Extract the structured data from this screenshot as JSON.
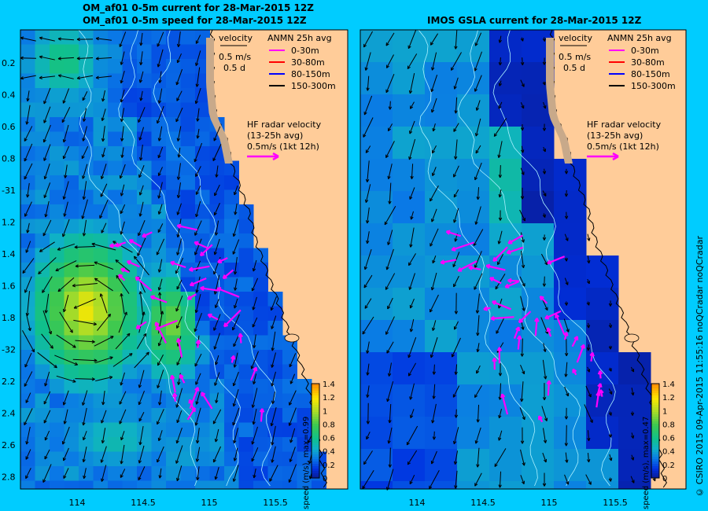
{
  "left_panel": {
    "title_line1": "OM_af01 0-5m current for 28-Mar-2015 12Z",
    "title_line2": "OM_af01 0-5m speed for 28-Mar-2015 12Z",
    "colorbar_label": "speed (m/s), max=0.99"
  },
  "right_panel": {
    "title_line1": "IMOS GSLA current for 28-Mar-2015 12Z",
    "colorbar_label": "speed (m/s), max=0.47"
  },
  "legend": {
    "velocity_label": "velocity",
    "ref_speed": "0.5 m/s",
    "ref_duration": "0.5 d",
    "anmn_title": "ANMN 25h avg",
    "anmn_items": [
      {
        "label": "0-30m",
        "color": "#ff00ff"
      },
      {
        "label": "30-80m",
        "color": "#ff0000"
      },
      {
        "label": "80-150m",
        "color": "#0000ff"
      },
      {
        "label": "150-300m",
        "color": "#000000"
      }
    ],
    "hf_title": "HF radar velocity",
    "hf_avg": "(13-25h avg)",
    "hf_ref": "0.5m/s (1kt 12h)",
    "hf_color": "#ff00ff"
  },
  "lat_ticks": [
    "0.2",
    "0.4",
    "0.6",
    "0.8",
    "-31",
    "1.2",
    "1.4",
    "1.6",
    "1.8",
    "-32",
    "2.2",
    "2.4",
    "2.6",
    "2.8"
  ],
  "lon_ticks": [
    "114",
    "114.5",
    "115",
    "115.5"
  ],
  "colorbar_ticks": [
    "0",
    "0.2",
    "0.4",
    "0.6",
    "0.8",
    "1",
    "1.2",
    "1.4"
  ],
  "credit": "© CSIRO 2015  09-Apr-2015 11:55:16 noQCradar noQCradar",
  "colors": {
    "background": "#00ccff",
    "land": "#ffcc99",
    "shelf": "#c8a98a",
    "hf_arrow": "#ff00ff"
  }
}
